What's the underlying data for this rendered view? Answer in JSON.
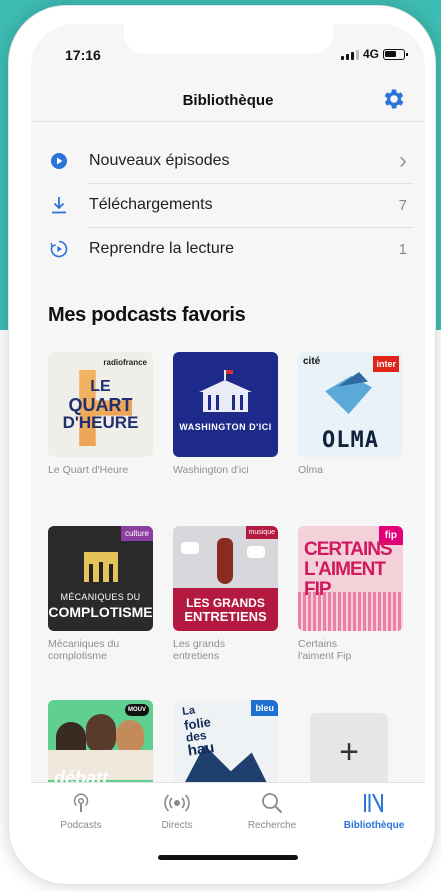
{
  "status": {
    "time": "17:16",
    "network": "4G"
  },
  "header": {
    "title": "Bibliothèque"
  },
  "menu": [
    {
      "label": "Nouveaux épisodes",
      "trail": "›"
    },
    {
      "label": "Téléchargements",
      "trail": "7"
    },
    {
      "label": "Reprendre la lecture",
      "trail": "1"
    }
  ],
  "section": {
    "title": "Mes podcasts favoris"
  },
  "podcasts": [
    {
      "label": "Le Quart d'Heure",
      "cover_text": [
        "LE",
        "QUART",
        "D'HEURE"
      ],
      "brand": "radiofrance"
    },
    {
      "label": "Washington d'ici",
      "cover_text": "WASHINGTON D'ICI"
    },
    {
      "label": "Olma",
      "cover_text": "OLMA",
      "brand": "cité",
      "badge": "inter"
    },
    {
      "label": "Mécaniques du complotisme",
      "cover_text": [
        "MÉCANIQUES DU",
        "COMPLOTISME"
      ],
      "badge": "culture"
    },
    {
      "label": "Les grands entretiens",
      "cover_text": [
        "LES GRANDS",
        "ENTRETIENS"
      ],
      "badge": "musique"
    },
    {
      "label": "Certains l'aiment Fip",
      "cover_text": [
        "CERTAINS",
        "L'AIMENT",
        "FIP"
      ],
      "badge": "fip"
    },
    {
      "label": "",
      "cover_text": "débatt",
      "badge": "MOUV"
    },
    {
      "label": "",
      "cover_text": [
        "La",
        "folie",
        "des",
        "hau"
      ],
      "badge": "bleu"
    }
  ],
  "add_button": {
    "label": "+"
  },
  "tabs": [
    {
      "label": "Podcasts",
      "icon": "podcast-icon"
    },
    {
      "label": "Directs",
      "icon": "live-icon"
    },
    {
      "label": "Recherche",
      "icon": "search-icon"
    },
    {
      "label": "Bibliothèque",
      "icon": "library-icon",
      "active": true
    }
  ],
  "colors": {
    "accent": "#2a73d9",
    "teal": "#3dbdb3"
  }
}
